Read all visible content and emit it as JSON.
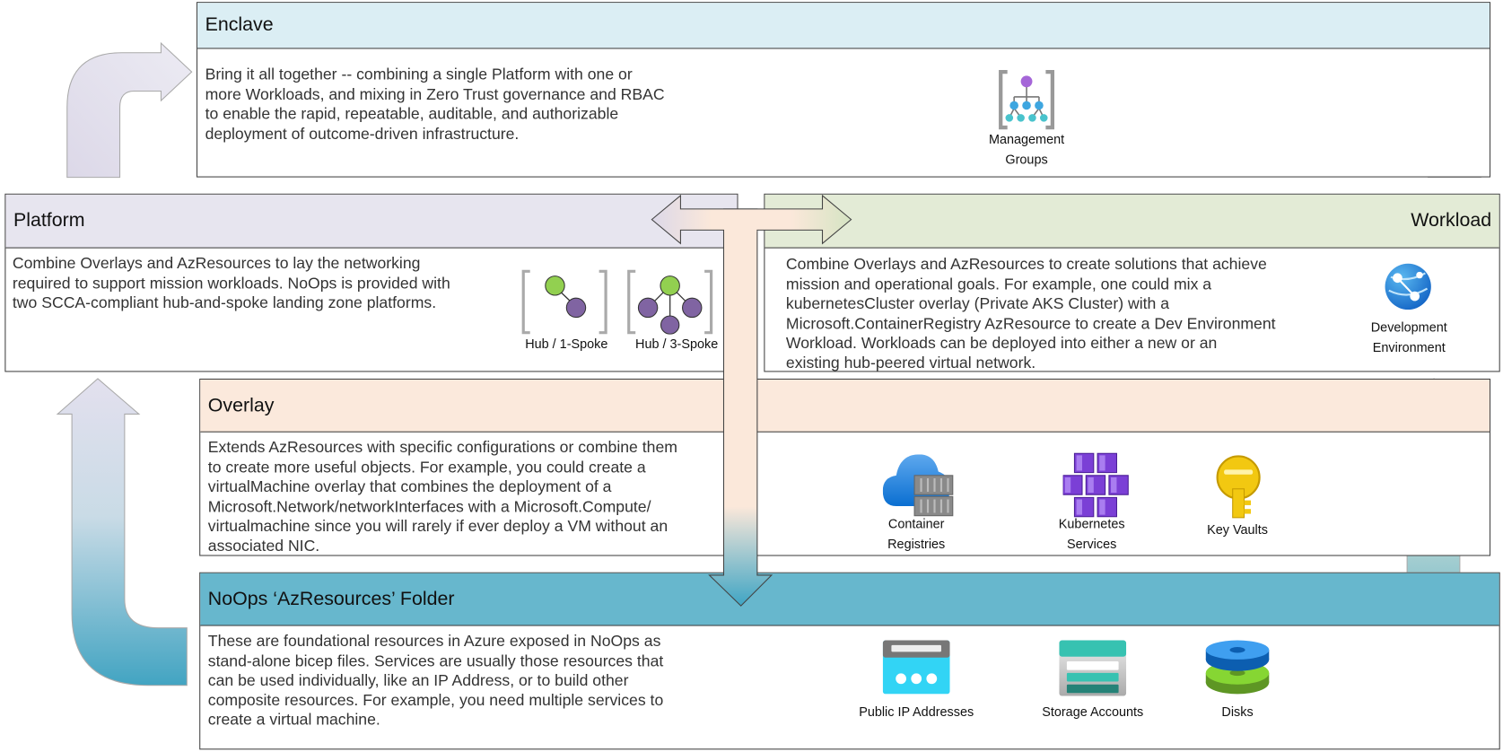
{
  "colors": {
    "enclave_header": "#dbeef4",
    "platform_header": "#e7e5ef",
    "workload_header": "#e3ebd6",
    "overlay_header": "#fbe9dc",
    "azresources_header": "#67b7cd"
  },
  "enclave": {
    "title": "Enclave",
    "lines": [
      "Bring it all together -- combining a single Platform with one or",
      "more Workloads, and mixing in Zero Trust governance and RBAC",
      "to enable the rapid, repeatable, auditable, and authorizable",
      "deployment of outcome-driven infrastructure."
    ],
    "icons": [
      {
        "icon": "management-groups-icon",
        "label_lines": [
          "Management",
          "Groups"
        ]
      }
    ]
  },
  "platform": {
    "title": "Platform",
    "lines": [
      "Combine Overlays and AzResources to lay the networking",
      "required to support mission workloads. NoOps is provided with",
      "two SCCA-compliant hub-and-spoke landing zone platforms."
    ],
    "icons": [
      {
        "icon": "hub-1-spoke-icon",
        "label": "Hub / 1-Spoke"
      },
      {
        "icon": "hub-3-spoke-icon",
        "label": "Hub / 3-Spoke"
      }
    ]
  },
  "workload": {
    "title": "Workload",
    "lines": [
      "Combine Overlays and AzResources to create solutions that achieve",
      "mission and operational goals. For example, one could mix a",
      "kubernetesCluster overlay (Private AKS Cluster) with a",
      "Microsoft.ContainerRegistry AzResource to create a Dev Environment",
      "Workload. Workloads can be deployed into either a new or an",
      "existing hub-peered virtual network."
    ],
    "icons": [
      {
        "icon": "development-environment-icon",
        "label_lines": [
          "Development",
          "Environment"
        ]
      }
    ]
  },
  "overlay": {
    "title": "Overlay",
    "lines": [
      "Extends AzResources with specific configurations or combine them",
      "to create more useful objects.  For example, you could create a",
      "virtualMachine overlay that combines the deployment of a",
      "Microsoft.Network/networkInterfaces with a Microsoft.Compute/",
      "virtualmachine since you will rarely if ever deploy a VM without an",
      "associated NIC."
    ],
    "icons": [
      {
        "icon": "container-registries-icon",
        "label_lines": [
          "Container",
          "Registries"
        ]
      },
      {
        "icon": "kubernetes-services-icon",
        "label_lines": [
          "Kubernetes",
          "Services"
        ]
      },
      {
        "icon": "key-vaults-icon",
        "label_lines": [
          "Key Vaults"
        ]
      }
    ]
  },
  "azresources": {
    "title": "NoOps ‘AzResources’ Folder",
    "lines": [
      "These are foundational resources in Azure exposed in NoOps as",
      "stand-alone bicep files.  Services are usually those resources that",
      "can be used individually, like an IP Address, or to build other",
      "composite resources.  For example, you need multiple services to",
      "create a virtual machine."
    ],
    "icons": [
      {
        "icon": "public-ip-addresses-icon",
        "label": "Public IP Addresses"
      },
      {
        "icon": "storage-accounts-icon",
        "label": "Storage Accounts"
      },
      {
        "icon": "disks-icon",
        "label": "Disks"
      }
    ]
  }
}
